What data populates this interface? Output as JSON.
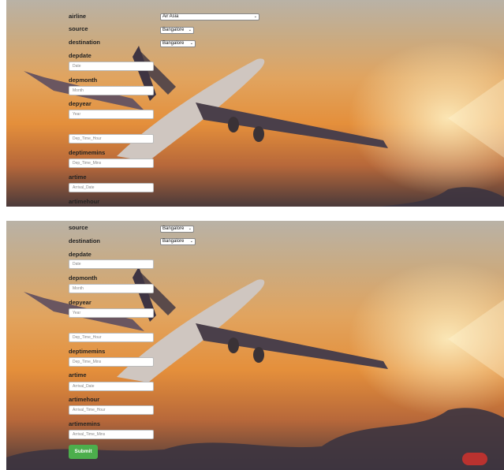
{
  "form_top": {
    "airline_label": "airline",
    "airline_value": "Air Asia",
    "source_label": "source",
    "source_value": "Bangalore",
    "destination_label": "destination",
    "destination_value": "Bangalore",
    "depdate_label": "depdate",
    "depdate_placeholder": "Date",
    "depmonth_label": "depmonth",
    "depmonth_placeholder": "Month",
    "depyear_label": "depyear",
    "depyear_placeholder": "Year",
    "deptimehour_placeholder": "Dep_Time_Hour",
    "deptimemins_label": "deptimemins",
    "deptimemins_placeholder": "Dep_Time_Mins",
    "artime_label": "artime",
    "artime_placeholder": "Arrival_Date",
    "artimehour_label": "artimehour"
  },
  "form_bottom": {
    "source_label": "source",
    "source_value": "Bangalore",
    "destination_label": "destination",
    "destination_value": "Bangalore",
    "depdate_label": "depdate",
    "depdate_placeholder": "Date",
    "depmonth_label": "depmonth",
    "depmonth_placeholder": "Month",
    "depyear_label": "depyear",
    "depyear_placeholder": "Year",
    "deptimehour_placeholder": "Dep_Time_Hour",
    "deptimemins_label": "deptimemins",
    "deptimemins_placeholder": "Dep_Time_Mins",
    "artime_label": "artime",
    "artime_placeholder": "Arrival_Date",
    "artimehour_label": "artimehour",
    "artimehour_placeholder": "Arrival_Time_Hour",
    "artimemins_label": "artimemins",
    "artimemins_placeholder": "Arrival_Time_Mins",
    "submit_label": "Submit"
  },
  "icons": {
    "dropdown": "chevron-down-icon"
  },
  "colors": {
    "submit_button": "#4cae4c",
    "sky_orange": "#e48f3b"
  }
}
